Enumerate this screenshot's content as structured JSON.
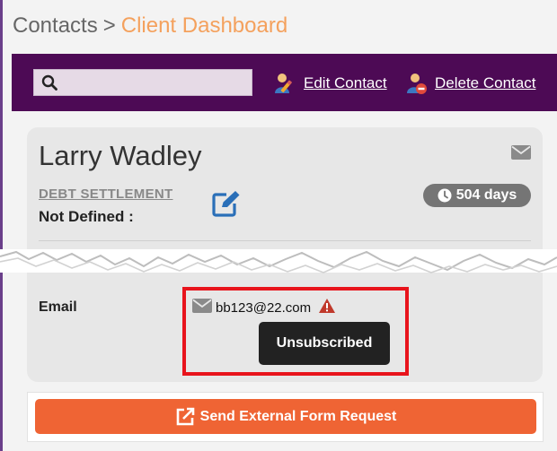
{
  "breadcrumb": {
    "root": "Contacts",
    "separator": ">",
    "current": "Client Dashboard"
  },
  "toolbar": {
    "search": {
      "value": "",
      "placeholder": ""
    },
    "edit_contact_label": "Edit Contact",
    "delete_contact_label": "Delete Contact"
  },
  "contact": {
    "name": "Larry Wadley",
    "program": "DEBT SETTLEMENT",
    "status": "Not Defined :",
    "days_label": "504 days",
    "email_label": "Email",
    "email": "bb123@22.com",
    "email_tooltip": "Unsubscribed"
  },
  "actions": {
    "send_form_label": "Send External Form Request"
  },
  "icons": {
    "search": "search-icon",
    "edit_contact": "edit-contact-icon",
    "delete_contact": "delete-contact-icon",
    "mail": "envelope-icon",
    "edit": "edit-icon",
    "clock": "clock-icon",
    "warning": "warning-icon",
    "external_link": "external-link-icon"
  },
  "colors": {
    "toolbar": "#4d0a55",
    "breadcrumb_current": "#f4a15d",
    "primary_button": "#ef6434",
    "highlight_border": "#e8141c",
    "badge": "#757575",
    "tooltip": "#222222",
    "warning": "#c0392b",
    "edit_icon": "#2a6fb8"
  }
}
